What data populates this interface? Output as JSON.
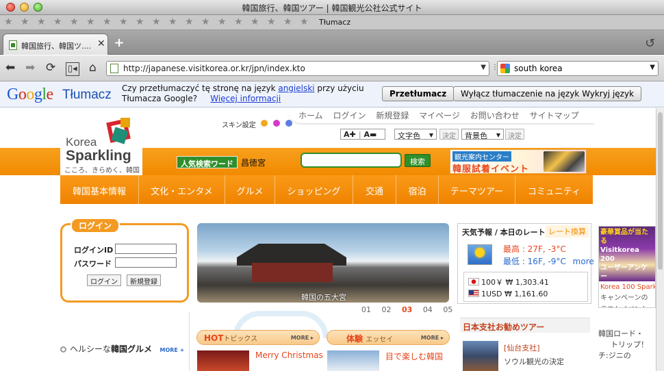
{
  "window": {
    "title": "韓国旅行、韓国ツアー | 韓国観光公社公式サイト"
  },
  "bookmarks": {
    "label": "Tłumacz"
  },
  "tab": {
    "title": "韓国旅行、韓国ツ....",
    "close": "✕",
    "new": "+"
  },
  "toolbar": {
    "url": "http://japanese.visitkorea.or.kr/jpn/index.kto",
    "search_value": "south korea",
    "icons": [
      "back-arrow-icon",
      "forward-arrow-icon",
      "reload-icon",
      "tab-switch-icon",
      "home-icon"
    ]
  },
  "translate_bar": {
    "logo": "Google",
    "product": "Tłumacz",
    "message_line1": "Czy przetłumaczyć tę stronę na język",
    "language_link": "angielski",
    "message_mid": "przy użyciu",
    "message_line2": "Tłumacza Google?",
    "more_info_link": "Więcej informacji",
    "translate_button": "Przetłumacz",
    "disable_button": "Wyłącz tłumaczenie na język Wykryj język"
  },
  "site": {
    "logo_korea": "Korea",
    "logo_sparkling": "Sparkling",
    "logo_tagline": "こころ、きらめく、韓国",
    "skin_label": "スキン設定",
    "skin_colors": [
      "#f2a81f",
      "#d63acb",
      "#5b7fe0"
    ],
    "top_nav": [
      "ホーム",
      "ログイン",
      "新規登録",
      "マイページ",
      "お問い合わせ",
      "サイトマップ"
    ],
    "font_size": {
      "plus": "A✚",
      "minus": "A▬"
    },
    "text_color_select": "文字色",
    "bg_color_select": "背景色",
    "decide": "決定",
    "popular_keyword_label": "人気検索ワード",
    "popular_keyword": "昌徳宮",
    "search_button": "検索",
    "banner": {
      "line1": "観光案内センター",
      "line2": "韓服試着イベント"
    },
    "main_nav": [
      "韓国基本情報",
      "文化・エンタメ",
      "グルメ",
      "ショッピング",
      "交通",
      "宿泊",
      "テーマツアー",
      "コミュニティ"
    ],
    "login": {
      "title": "ログイン",
      "id_label": "ログインID",
      "password_label": "パスワード",
      "login_button": "ログイン",
      "register_button": "新規登録"
    },
    "hero": {
      "caption": "韓国の五大宮",
      "pages": [
        "01",
        "02",
        "03",
        "04",
        "05"
      ],
      "current": "03"
    },
    "weather": {
      "header": "天気予報 / 本日のレート",
      "rate_tab": "レート換算",
      "high": "最高 : 27F, -3°C",
      "low": "最低 : 16F, -9°C",
      "more": "more",
      "jpy": "100￥ ₩ 1,303.41",
      "usd": "1USD ₩ 1,161.60"
    },
    "side_ad": {
      "top_lines": [
        "豪華賞品が当たる",
        "Visitkorea 200",
        "ユーザーアンケー"
      ],
      "line1": "Korea 100 Spark",
      "line2": "キャンペーンの",
      "line3": "ラストイベント"
    },
    "side_ad2": [
      "韓国ロード・",
      "トリップ！",
      "チ:ジニの"
    ],
    "health": {
      "prefix": "ヘルシーな",
      "bold": "韓国グルメ",
      "more": "MORE +"
    },
    "hot_topics": {
      "label_hot": "HOT",
      "label_rest": "トピックス",
      "more": "MORE ▸",
      "item": "Merry Christmas"
    },
    "taiken": {
      "label_bold": "体験",
      "label_rest": "エッセイ",
      "more": "MORE ▸",
      "item": "目で楽しむ韓国"
    },
    "recommend": {
      "title": "日本支社お勧めツアー",
      "line1": "[仙台支社]",
      "line2": "ソウル観光の決定"
    }
  }
}
